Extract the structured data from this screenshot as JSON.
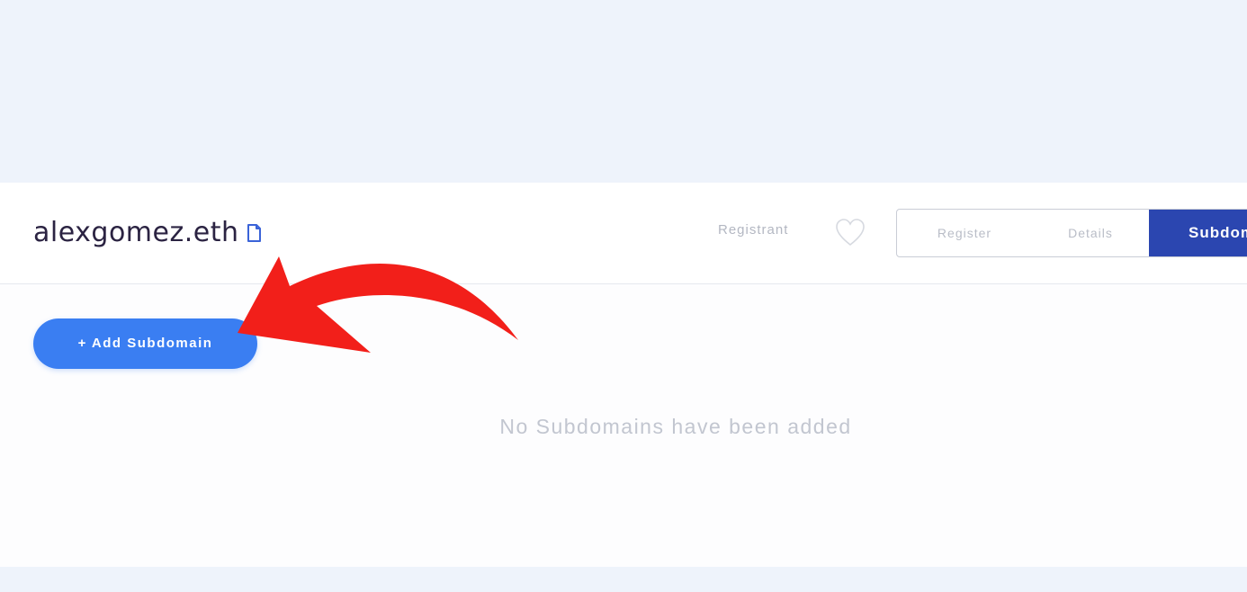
{
  "domain": {
    "name": "alexgomez.eth",
    "copy_icon": "file-icon"
  },
  "nav": {
    "registrant_label": "Registrant",
    "favorite_icon": "heart-icon",
    "tabs": [
      {
        "label": "Register",
        "active": false
      },
      {
        "label": "Details",
        "active": false
      },
      {
        "label": "Subdomains",
        "active": true
      }
    ]
  },
  "subdomains": {
    "add_button_label": "+ Add Subdomain",
    "empty_message": "No Subdomains have been added"
  },
  "colors": {
    "page_background": "#eef3fb",
    "active_tab": "#2b46b0",
    "add_button": "#3a7ef2",
    "annotation_arrow": "#f21f1a",
    "title_text": "#2b2342",
    "muted_text": "#c2c6d0"
  },
  "annotation": {
    "icon": "curved-arrow-icon"
  }
}
